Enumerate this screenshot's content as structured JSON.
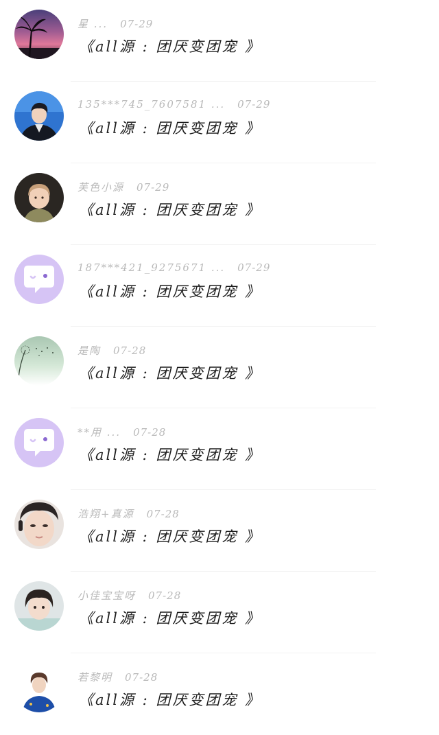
{
  "colors": {
    "background": "#ffffff",
    "meta_text": "#b9b9b9",
    "message_text": "#1e1e1e",
    "default_avatar_bg": "#d6c4f5",
    "default_avatar_bubble": "#ffffff"
  },
  "comments": [
    {
      "username": "星 ...",
      "date": "07-29",
      "message": "《all源 : 团厌变团宠 》",
      "avatar": "sunset-palm-avatar"
    },
    {
      "username": "135***745_7607581 ...",
      "date": "07-29",
      "message": "《all源 : 团厌变团宠 》",
      "avatar": "suit-portrait-avatar"
    },
    {
      "username": "芙色小源",
      "date": "07-29",
      "message": "《all源 : 团厌变团宠 》",
      "avatar": "baby-portrait-avatar"
    },
    {
      "username": "187***421_9275671 ...",
      "date": "07-29",
      "message": "《all源 : 团厌变团宠 》",
      "avatar": "default-chat-bubble-avatar"
    },
    {
      "username": "是陶",
      "date": "07-28",
      "message": "《all源 : 团厌变团宠 》",
      "avatar": "dandelion-avatar"
    },
    {
      "username": "**用 ...",
      "date": "07-28",
      "message": "《all源 : 团厌变团宠 》",
      "avatar": "default-chat-bubble-avatar"
    },
    {
      "username": "浩翔+真源",
      "date": "07-28",
      "message": "《all源 : 团厌变团宠 》",
      "avatar": "face-closeup-avatar"
    },
    {
      "username": "小佳宝宝呀",
      "date": "07-28",
      "message": "《all源 : 团厌变团宠 》",
      "avatar": "child-portrait-avatar"
    },
    {
      "username": "若黎明",
      "date": "07-28",
      "message": "《all源 : 团厌变团宠 》",
      "avatar": "blue-jacket-portrait-avatar"
    }
  ]
}
